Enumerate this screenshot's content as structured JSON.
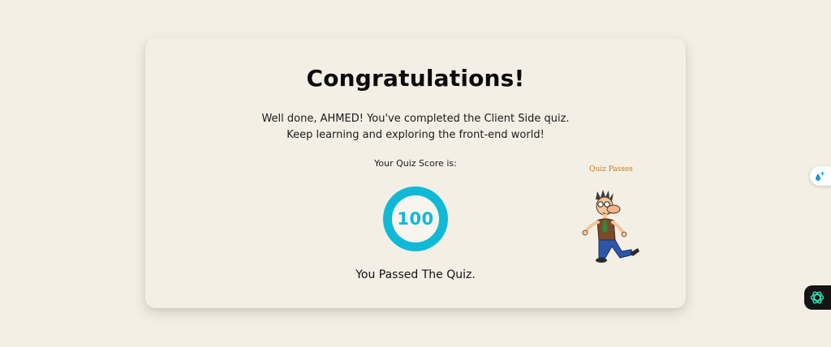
{
  "card": {
    "title": "Congratulations!",
    "message_line1": "Well done, AHMED! You've completed the Client Side quiz.",
    "message_line2": "Keep learning and exploring the front-end world!",
    "score_label": "Your Quiz Score is:",
    "score": "100",
    "result": "You Passed The Quiz.",
    "mascot_caption": "Quiz Passes"
  },
  "colors": {
    "background": "#f4efe4",
    "card": "#f3efe5",
    "accent": "#10b9d6",
    "caption": "#c67a1a",
    "assistant_bg": "#141414",
    "assistant_icon": "#2fd1a6"
  },
  "icons": {
    "side_button": "sparkle-drop-icon",
    "assistant_button": "chatgpt-icon"
  }
}
